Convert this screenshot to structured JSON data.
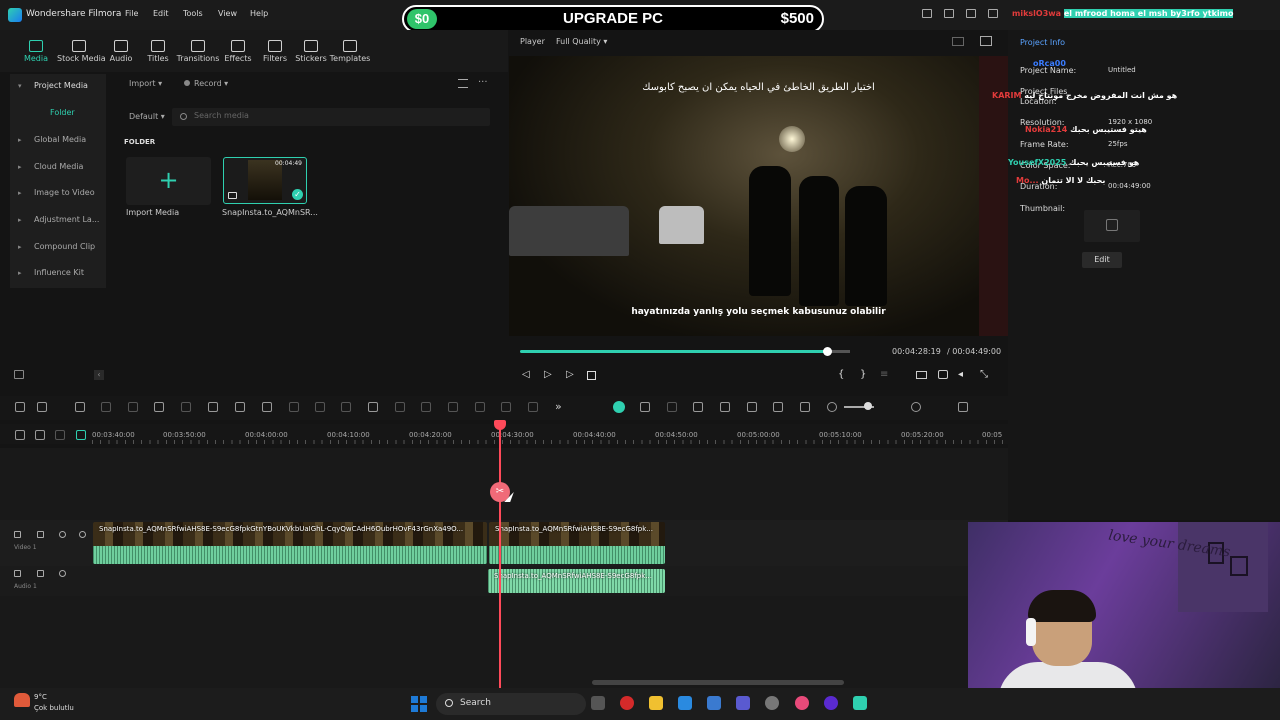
{
  "app": {
    "name": "Wondershare Filmora",
    "menu": [
      "File",
      "Edit",
      "Tools",
      "View",
      "Help"
    ]
  },
  "banner": {
    "left": "$0",
    "title": "UPGRADE PC",
    "right": "$500"
  },
  "toolbar": {
    "tabs": [
      "Media",
      "Stock Media",
      "Audio",
      "Titles",
      "Transitions",
      "Effects",
      "Filters",
      "Stickers",
      "Templates"
    ],
    "active": "Media"
  },
  "sidebar": {
    "items": [
      "Project Media",
      "Folder",
      "Global Media",
      "Cloud Media",
      "Image to Video",
      "Adjustment La...",
      "Compound Clip",
      "Influence Kit"
    ]
  },
  "media": {
    "import_label": "Import",
    "record_label": "Record",
    "sort_label": "Default",
    "search_placeholder": "Search media",
    "folder_heading": "FOLDER",
    "import_media_label": "Import Media",
    "clip_label": "SnapInsta.to_AQMnSR...",
    "clip_duration": "00:04:49"
  },
  "player": {
    "label": "Player",
    "quality": "Full Quality",
    "subtitle_arabic": "اختيار الطريق الخاطئ في الحياه يمكن ان يصبح كابوسك",
    "subtitle_turkish": "hayatınızda yanlış yolu seçmek kabusunuz olabilir",
    "time_current": "00:04:28:19",
    "time_total": "/ 00:04:49:00",
    "progress": 0.93
  },
  "properties": {
    "tab": "Project Info",
    "rows": [
      {
        "label": "Project Name:",
        "value": "Untitled"
      },
      {
        "label": "Project Files Location:",
        "value": ""
      },
      {
        "label": "Resolution:",
        "value": "1920 x 1080"
      },
      {
        "label": "Frame Rate:",
        "value": "25fps"
      },
      {
        "label": "Color Space:",
        "value": "Rec.709"
      },
      {
        "label": "Duration:",
        "value": "00:04:49:00"
      },
      {
        "label": "Thumbnail:",
        "value": ""
      }
    ],
    "edit_label": "Edit"
  },
  "chat": {
    "messages": [
      {
        "user": "mikslO3wa",
        "text": "el mfrood homa el msh by3rfo ytkimo"
      },
      {
        "user": "oRca00",
        "text": ""
      },
      {
        "user": "KARIM",
        "text": "هو مش انت المفروض مخرج مونتاج ليه"
      },
      {
        "user": "Nokia214",
        "text": "هيتو فستيبس بحبك"
      },
      {
        "user": "YousefX2025",
        "text": "هو فستيبس يحبك"
      },
      {
        "user": "Mo...",
        "text": "بحبك لا الا تتمان"
      }
    ]
  },
  "timeline": {
    "ruler": [
      "00:03:40:00",
      "00:03:50:00",
      "00:04:00:00",
      "00:04:10:00",
      "00:04:20:00",
      "00:04:30:00",
      "00:04:40:00",
      "00:04:50:00",
      "00:05:00:00",
      "00:05:10:00",
      "00:05:20:00",
      "00:05"
    ],
    "video_track": "Video 1",
    "audio_track": "Audio 1",
    "clip1_title": "SnapInsta.to_AQMnSRfwiAHS8E-S9ecG8fpkGtnYBoUKVkbUaIGhL-CqyQwCAdH6OubrHOvF43rGnXa49O...",
    "clip2_title": "SnapInsta.to_AQMnSRfwiAHS8E-S9ecG8fpk...",
    "audio_clip_title": "SnapInsta.to_AQMnSRfwiAHS8E-S9ecG8fpk..."
  },
  "webcam": {
    "wall_text": "love your dreams"
  },
  "taskbar": {
    "temperature": "9°C",
    "weather": "Çok bulutlu",
    "search": "Search"
  },
  "colors": {
    "accent": "#2fd0b0",
    "playhead": "#ff4a5a",
    "waveform": "#6fcf9e"
  }
}
